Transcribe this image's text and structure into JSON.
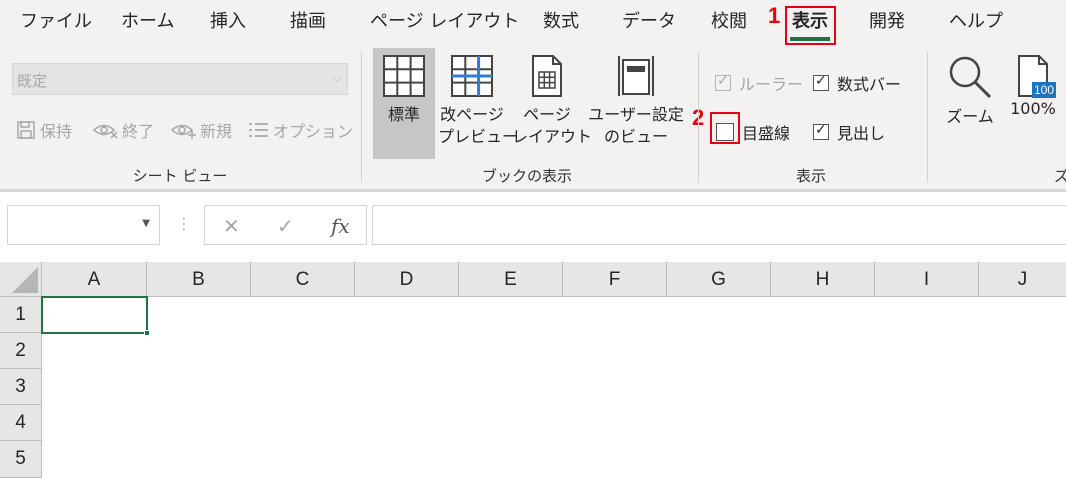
{
  "tabs": [
    "ファイル",
    "ホーム",
    "挿入",
    "描画",
    "ページ レイアウト",
    "数式",
    "データ",
    "校閲",
    "表示",
    "開発",
    "ヘルプ"
  ],
  "active_tab_index": 8,
  "callouts": {
    "step1": "1",
    "step2": "2"
  },
  "sheet_view": {
    "select_value": "既定",
    "buttons": [
      "保持",
      "終了",
      "新規",
      "オプション"
    ],
    "group_label": "シート ビュー"
  },
  "workbook_views": {
    "buttons": [
      {
        "line1": "標準",
        "line2": ""
      },
      {
        "line1": "改ページ",
        "line2": "プレビュー"
      },
      {
        "line1": "ページ",
        "line2": "レイアウト"
      },
      {
        "line1": "ユーザー設定",
        "line2": "のビュー"
      }
    ],
    "selected_index": 0,
    "group_label": "ブックの表示"
  },
  "show": {
    "ruler": {
      "label": "ルーラー",
      "checked": true,
      "disabled": true
    },
    "formula_bar": {
      "label": "数式バー",
      "checked": true
    },
    "gridlines": {
      "label": "目盛線",
      "checked": false
    },
    "headings": {
      "label": "見出し",
      "checked": true
    },
    "group_label": "表示"
  },
  "zoom": {
    "zoom_label": "ズーム",
    "zoom100_label": "100%",
    "zoom100_icon_text": "100",
    "group_label_partial": "ズ"
  },
  "formula_bar": {
    "name_box": "",
    "fx": "fx",
    "cancel": "✕",
    "enter": "✓"
  },
  "grid": {
    "columns": [
      "A",
      "B",
      "C",
      "D",
      "E",
      "F",
      "G",
      "H",
      "I",
      "J"
    ],
    "rows": [
      "1",
      "2",
      "3",
      "4",
      "5"
    ],
    "selected_cell": "A1"
  },
  "colors": {
    "accent": "#217346",
    "callout": "#e60012"
  }
}
